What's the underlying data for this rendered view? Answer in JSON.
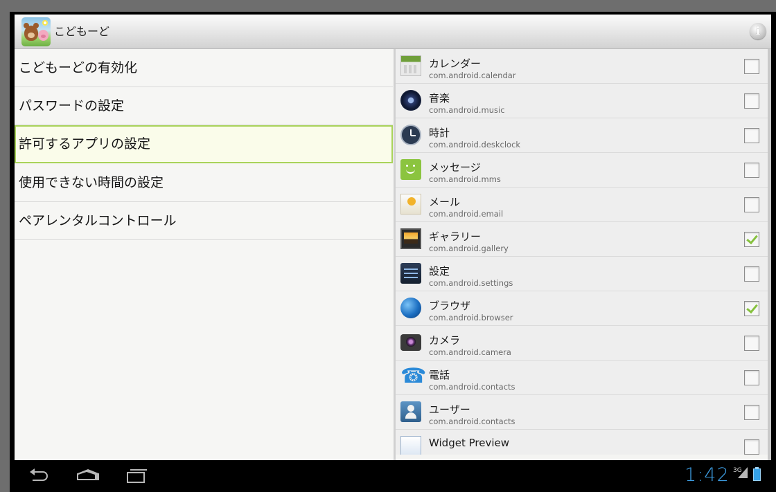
{
  "app": {
    "title": "こどもーど",
    "info_icon": "info-icon"
  },
  "settings_menu": {
    "items": [
      {
        "label": "こどもーどの有効化",
        "selected": false
      },
      {
        "label": "パスワードの設定",
        "selected": false
      },
      {
        "label": "許可するアプリの設定",
        "selected": true
      },
      {
        "label": "使用できない時間の設定",
        "selected": false
      },
      {
        "label": "ペアレンタルコントロール",
        "selected": false
      }
    ]
  },
  "app_list": [
    {
      "name": "カレンダー",
      "package": "com.android.calendar",
      "icon": "calendar-icon",
      "checked": false
    },
    {
      "name": "音楽",
      "package": "com.android.music",
      "icon": "music-icon",
      "checked": false
    },
    {
      "name": "時計",
      "package": "com.android.deskclock",
      "icon": "clock-icon",
      "checked": false
    },
    {
      "name": "メッセージ",
      "package": "com.android.mms",
      "icon": "message-icon",
      "checked": false
    },
    {
      "name": "メール",
      "package": "com.android.email",
      "icon": "mail-icon",
      "checked": false
    },
    {
      "name": "ギャラリー",
      "package": "com.android.gallery",
      "icon": "gallery-icon",
      "checked": true
    },
    {
      "name": "設定",
      "package": "com.android.settings",
      "icon": "settings-icon",
      "checked": false
    },
    {
      "name": "ブラウザ",
      "package": "com.android.browser",
      "icon": "browser-icon",
      "checked": true
    },
    {
      "name": "カメラ",
      "package": "com.android.camera",
      "icon": "camera-icon",
      "checked": false
    },
    {
      "name": "電話",
      "package": "com.android.contacts",
      "icon": "phone-icon",
      "checked": false
    },
    {
      "name": "ユーザー",
      "package": "com.android.contacts",
      "icon": "contacts-icon",
      "checked": false
    },
    {
      "name": "Widget Preview",
      "package": "",
      "icon": "widget-preview-icon",
      "checked": false
    }
  ],
  "status_bar": {
    "time": "1:42",
    "network": "3G",
    "signal_icon": "signal-icon",
    "battery_icon": "battery-icon"
  },
  "nav_bar": {
    "back_icon": "back-icon",
    "home_icon": "home-icon",
    "recents_icon": "recents-icon"
  },
  "colors": {
    "accent_selection": "#a9d35a",
    "check_mark": "#86c13e",
    "clock_text": "#3d9de2"
  }
}
